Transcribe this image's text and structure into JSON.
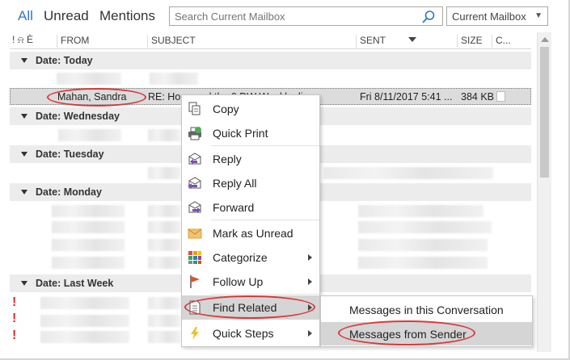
{
  "filters": {
    "all": "All",
    "unread": "Unread",
    "mentions": "Mentions"
  },
  "search": {
    "placeholder": "Search Current Mailbox",
    "scope": "Current Mailbox"
  },
  "columns": {
    "icons": "! ⍾ Ѐ",
    "from": "FROM",
    "subject": "SUBJECT",
    "sent": "SENT",
    "size": "SIZE",
    "categories": "C..."
  },
  "groups": {
    "today": "Date: Today",
    "wednesday": "Date: Wednesday",
    "tuesday": "Date: Tuesday",
    "monday": "Date: Monday",
    "last_week": "Date: Last Week"
  },
  "selected_row": {
    "from": "Mahan, Sandra",
    "subject": "RE: Ho... ...ed the 0 DW Weekly di...",
    "sent": "Fri 8/11/2017 5:41 ...",
    "size": "384 KB"
  },
  "importance_marks": [
    "!",
    "!",
    "!"
  ],
  "context_menu": {
    "copy": "Copy",
    "quick_print": "Quick Print",
    "reply": "Reply",
    "reply_all": "Reply All",
    "forward": "Forward",
    "mark_unread": "Mark as Unread",
    "categorize": "Categorize",
    "follow_up": "Follow Up",
    "find_related": "Find Related",
    "quick_steps": "Quick Steps"
  },
  "submenu": {
    "conversation": "Messages in this Conversation",
    "sender": "Messages from Sender"
  },
  "colors": {
    "accent": "#2b79c9",
    "highlight_oval": "#d9393b",
    "importance": "#d32f2f"
  }
}
